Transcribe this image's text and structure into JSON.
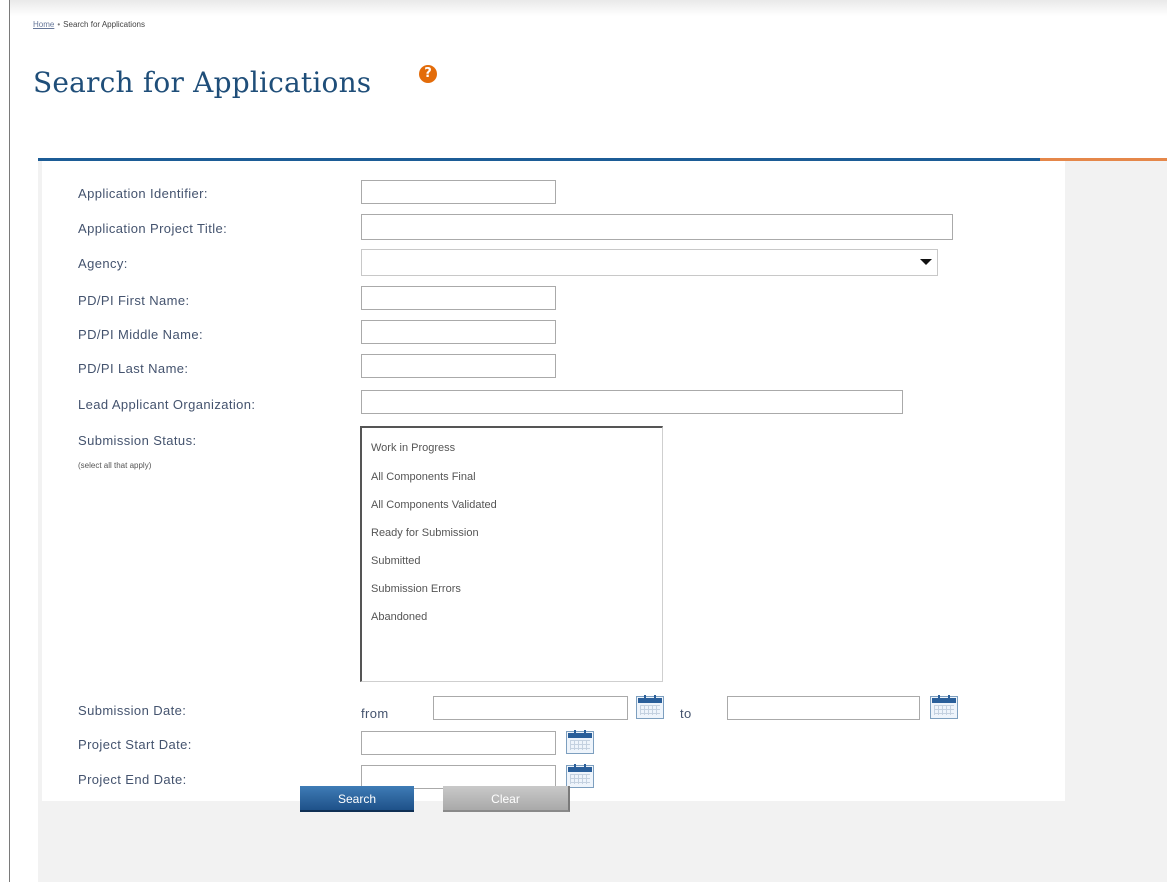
{
  "breadcrumb": {
    "home": "Home",
    "separator": "•",
    "current": "Search for Applications"
  },
  "page": {
    "title": "Search for Applications",
    "help_icon": "question-mark-icon"
  },
  "colors": {
    "title": "#1f4e79",
    "rule_blue": "#1c5c96",
    "rule_orange": "#e5874a",
    "help_icon": "#e36c0a",
    "search_button": "#1e5189",
    "clear_button": "#a9a9a9"
  },
  "form": {
    "application_identifier": {
      "label": "Application Identifier:",
      "value": ""
    },
    "project_title": {
      "label": "Application Project Title:",
      "value": ""
    },
    "agency": {
      "label": "Agency:",
      "value": ""
    },
    "pi_first_name": {
      "label": "PD/PI First Name:",
      "value": ""
    },
    "pi_middle_name": {
      "label": "PD/PI Middle Name:",
      "value": ""
    },
    "pi_last_name": {
      "label": "PD/PI Last Name:",
      "value": ""
    },
    "lead_org": {
      "label": "Lead Applicant Organization:",
      "value": ""
    },
    "submission_status": {
      "label": "Submission Status:",
      "hint": "(select all that apply)",
      "options": [
        "Work in Progress",
        "All Components Final",
        "All Components Validated",
        "Ready for Submission",
        "Submitted",
        "Submission Errors",
        "Abandoned"
      ]
    },
    "submission_date": {
      "label": "Submission Date:",
      "from_label": "from",
      "to_label": "to",
      "from_value": "",
      "to_value": ""
    },
    "project_start_date": {
      "label": "Project Start Date:",
      "value": ""
    },
    "project_end_date": {
      "label": "Project End Date:",
      "value": ""
    }
  },
  "buttons": {
    "search": "Search",
    "clear": "Clear"
  }
}
